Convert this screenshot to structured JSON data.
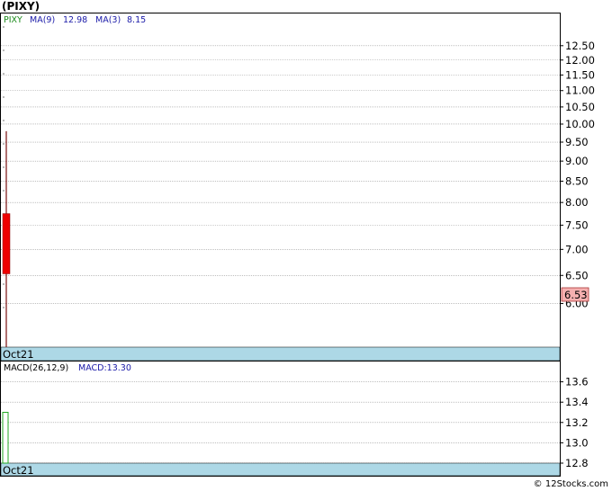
{
  "header": {
    "title": "(PIXY)"
  },
  "footer": {
    "text": "© 12Stocks.com"
  },
  "price_legend": {
    "symbol": "PIXY",
    "ma9_label": "MA(9)",
    "ma9_value": "12.98",
    "ma3_label": "MA(3)",
    "ma3_value": "8.15"
  },
  "macd_legend": {
    "label": "MACD(26,12,9)",
    "value_text": "MACD:13.30"
  },
  "x_label": "Oct21",
  "last_price": "6.53",
  "colors": {
    "up": "#22aa22",
    "down": "#ee0000",
    "wick": "#7a1010",
    "axis_band": "#add8e6",
    "legend_blue": "#1a1aa8",
    "legend_green": "#1a8a1a",
    "tag_fill": "#f5b0b0"
  },
  "chart_data": [
    {
      "type": "candlestick",
      "y_ticks": [
        "12.50",
        "12.00",
        "11.50",
        "11.00",
        "10.50",
        "10.00",
        "9.50",
        "9.00",
        "8.50",
        "8.00",
        "7.50",
        "7.00",
        "6.50",
        "6.00"
      ],
      "y_scale": "log",
      "ylim": [
        5.3,
        13.7
      ],
      "x_tick_labels": [
        "Oct21"
      ],
      "candles": [
        {
          "x": "Oct21",
          "open": 7.75,
          "high": 9.8,
          "low": 5.3,
          "close": 6.53
        }
      ],
      "grid": true
    },
    {
      "type": "bar",
      "title": "MACD(26,12,9)",
      "y_ticks": [
        "13.6",
        "13.4",
        "13.2",
        "13.0",
        "12.8"
      ],
      "ylim": [
        12.8,
        13.8
      ],
      "x_tick_labels": [
        "Oct21"
      ],
      "values": [
        13.3
      ],
      "grid": true
    }
  ]
}
